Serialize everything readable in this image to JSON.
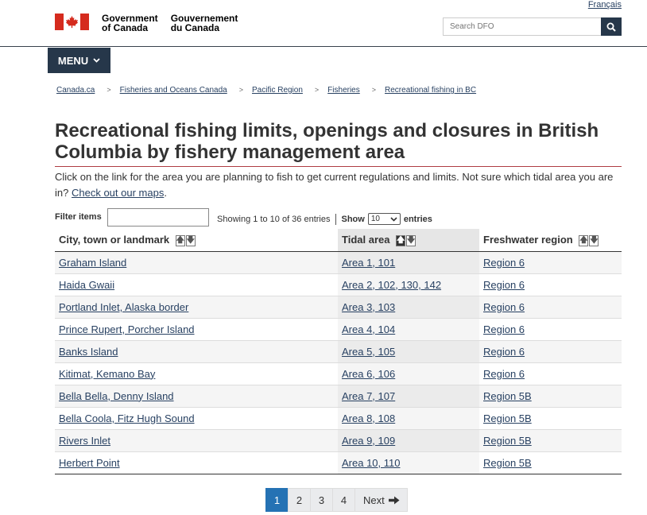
{
  "header": {
    "language_link": "Français",
    "signature": {
      "en": [
        "Government",
        "of Canada"
      ],
      "fr": [
        "Gouvernement",
        "du Canada"
      ]
    },
    "search": {
      "placeholder": "Search DFO"
    },
    "menu_label": "MENU"
  },
  "breadcrumb": [
    "Canada.ca",
    "Fisheries and Oceans Canada",
    "Pacific Region",
    "Fisheries",
    "Recreational fishing in BC"
  ],
  "page": {
    "title": "Recreational fishing limits, openings and closures in British Columbia by fishery management area",
    "intro_text": "Click on the link for the area you are planning to fish to get current regulations and limits. Not sure which tidal area you are in?",
    "intro_link": "Check out our maps",
    "intro_end": "."
  },
  "table_controls": {
    "filter_label": "Filter items",
    "info": "Showing 1 to 10 of 36 entries",
    "show_label": "Show",
    "page_length": "10",
    "entries_label": "entries"
  },
  "table": {
    "columns": [
      "City, town or landmark",
      "Tidal area",
      "Freshwater region"
    ],
    "sorted_column": "Tidal area",
    "rows": [
      [
        "Graham Island",
        "Area 1, 101",
        "Region 6"
      ],
      [
        "Haida Gwaii",
        "Area 2, 102, 130, 142",
        "Region 6"
      ],
      [
        "Portland Inlet, Alaska border",
        "Area 3, 103",
        "Region 6"
      ],
      [
        "Prince Rupert, Porcher Island",
        "Area 4, 104",
        "Region 6"
      ],
      [
        "Banks Island",
        "Area 5, 105",
        "Region 6"
      ],
      [
        "Kitimat, Kemano Bay",
        "Area 6, 106",
        "Region 6"
      ],
      [
        "Bella Bella, Denny Island",
        "Area 7, 107",
        "Region 5B"
      ],
      [
        "Bella Coola, Fitz Hugh Sound",
        "Area 8, 108",
        "Region 5B"
      ],
      [
        "Rivers Inlet",
        "Area 9, 109",
        "Region 5B"
      ],
      [
        "Herbert Point",
        "Area 10, 110",
        "Region 5B"
      ]
    ]
  },
  "pagination": {
    "pages": [
      "1",
      "2",
      "3",
      "4"
    ],
    "current": "1",
    "next_label": "Next"
  },
  "colors": {
    "flag_red": "#d52b1e",
    "header_dark": "#26374a",
    "link": "#284162",
    "title_rule": "#af3c43",
    "pager_active": "#2572b4"
  }
}
